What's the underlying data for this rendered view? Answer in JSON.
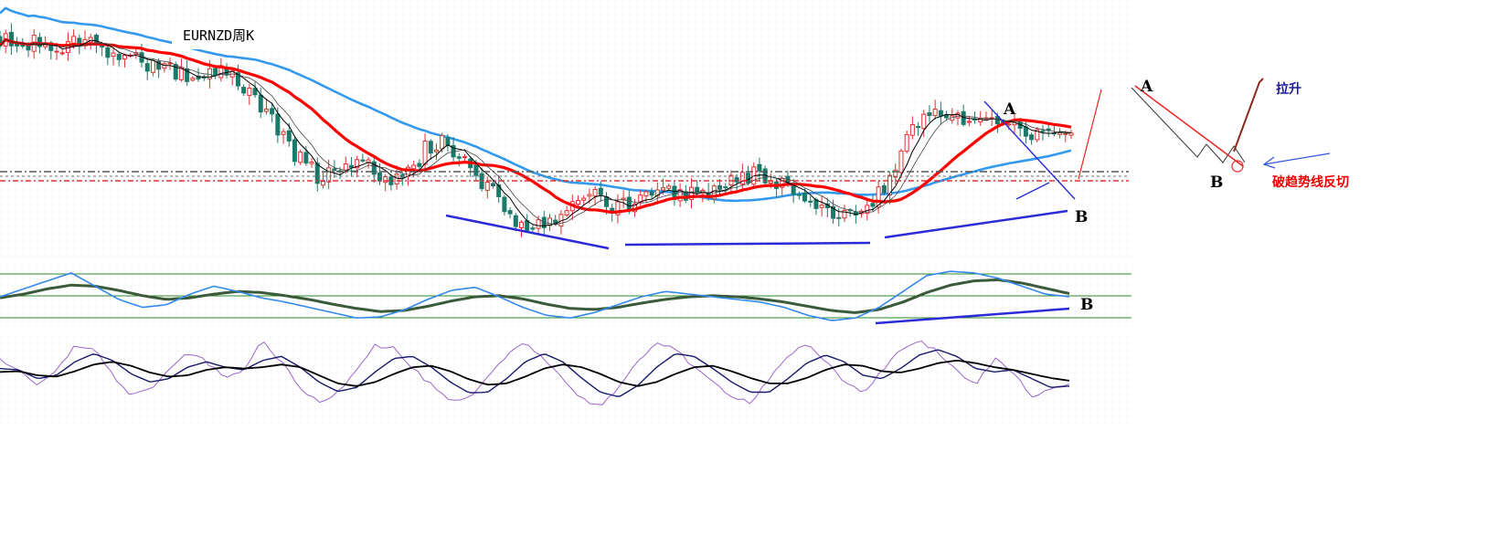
{
  "title": "EURNZD周K",
  "annotations": {
    "label_a_main": "A",
    "label_b_main": "B",
    "label_b_indicator": "B",
    "label_a_sketch": "A",
    "label_b_sketch": "B",
    "label_lift": "拉升",
    "label_break": "破趋势线反切"
  },
  "colors": {
    "bull_candle": "#e03030",
    "bear_candle": "#1a7a6a",
    "ma_fast": "#000000",
    "ma_mid": "#ff0000",
    "ma_slow": "#3399ee",
    "trendline": "#2a2ad8",
    "lift_label": "#1a1a9a",
    "break_label": "#ee0000",
    "osc_fast": "#3388ee",
    "osc_slow": "#3a5a3a",
    "stoch_line": "#9966cc",
    "grid": "#cccccc",
    "guide": "#2a8a2a"
  },
  "chart_data": [
    {
      "type": "candlestick",
      "symbol": "EURNZD",
      "timeframe": "周K",
      "trend": [
        1.0,
        0.97,
        0.98,
        0.93,
        0.95,
        0.99,
        0.96,
        0.9,
        0.88,
        0.86,
        0.84,
        0.82,
        0.8,
        0.82,
        0.78,
        0.7,
        0.6,
        0.46,
        0.36,
        0.3,
        0.33,
        0.38,
        0.34,
        0.28,
        0.32,
        0.44,
        0.5,
        0.4,
        0.3,
        0.22,
        0.1,
        0.04,
        0.08,
        0.14,
        0.18,
        0.22,
        0.16,
        0.16,
        0.2,
        0.24,
        0.2,
        0.22,
        0.26,
        0.28,
        0.32,
        0.3,
        0.26,
        0.22,
        0.18,
        0.14,
        0.12,
        0.16,
        0.26,
        0.42,
        0.58,
        0.64,
        0.6,
        0.58,
        0.6,
        0.56,
        0.52,
        0.5,
        0.52,
        0.55
      ],
      "moving_averages": [
        "fast",
        "mid",
        "slow"
      ],
      "trendlines": 4,
      "grid": true
    },
    {
      "type": "line",
      "indicator": "oscillator",
      "series": [
        {
          "values": [
            0.5,
            0.65,
            0.8,
            0.95,
            0.7,
            0.45,
            0.3,
            0.35,
            0.55,
            0.7,
            0.6,
            0.48,
            0.4,
            0.3,
            0.2,
            0.1,
            0.12,
            0.25,
            0.45,
            0.62,
            0.68,
            0.5,
            0.3,
            0.15,
            0.1,
            0.2,
            0.35,
            0.5,
            0.6,
            0.55,
            0.5,
            0.45,
            0.4,
            0.3,
            0.15,
            0.05,
            0.1,
            0.3,
            0.6,
            0.9,
            0.98,
            0.95,
            0.85,
            0.7,
            0.55,
            0.5
          ]
        },
        {
          "values": [
            0.48,
            0.55,
            0.65,
            0.72,
            0.7,
            0.62,
            0.52,
            0.45,
            0.48,
            0.55,
            0.6,
            0.58,
            0.52,
            0.45,
            0.36,
            0.28,
            0.22,
            0.24,
            0.32,
            0.42,
            0.5,
            0.52,
            0.46,
            0.36,
            0.28,
            0.26,
            0.3,
            0.38,
            0.45,
            0.5,
            0.52,
            0.5,
            0.46,
            0.4,
            0.32,
            0.24,
            0.2,
            0.26,
            0.4,
            0.58,
            0.72,
            0.8,
            0.82,
            0.76,
            0.66,
            0.56
          ]
        }
      ],
      "grid": true
    },
    {
      "type": "line",
      "indicator": "stochastic",
      "series": [
        {
          "values": [
            0.75,
            0.55,
            0.35,
            0.55,
            0.95,
            0.9,
            0.5,
            0.2,
            0.3,
            0.55,
            0.85,
            0.7,
            0.45,
            0.6,
            1.0,
            0.7,
            0.3,
            0.1,
            0.25,
            0.6,
            0.95,
            0.9,
            0.6,
            0.35,
            0.1,
            0.15,
            0.45,
            0.8,
            1.0,
            0.75,
            0.45,
            0.15,
            0.05,
            0.3,
            0.7,
            1.0,
            0.9,
            0.6,
            0.4,
            0.2,
            0.1,
            0.45,
            0.8,
            0.95,
            0.7,
            0.4,
            0.25,
            0.55,
            0.9,
            1.0,
            0.85,
            0.55,
            0.35,
            0.75,
            0.55,
            0.2,
            0.3,
            0.35
          ]
        },
        {
          "values": [
            0.6,
            0.58,
            0.45,
            0.5,
            0.7,
            0.82,
            0.72,
            0.52,
            0.4,
            0.45,
            0.62,
            0.7,
            0.62,
            0.58,
            0.72,
            0.78,
            0.62,
            0.4,
            0.26,
            0.32,
            0.55,
            0.75,
            0.78,
            0.62,
            0.4,
            0.24,
            0.25,
            0.45,
            0.7,
            0.82,
            0.7,
            0.46,
            0.25,
            0.18,
            0.35,
            0.62,
            0.82,
            0.78,
            0.6,
            0.4,
            0.25,
            0.25,
            0.45,
            0.68,
            0.8,
            0.7,
            0.5,
            0.45,
            0.6,
            0.8,
            0.88,
            0.78,
            0.6,
            0.55,
            0.58,
            0.45,
            0.32,
            0.34
          ]
        },
        {
          "values": [
            0.55,
            0.56,
            0.5,
            0.48,
            0.56,
            0.66,
            0.7,
            0.64,
            0.54,
            0.48,
            0.5,
            0.58,
            0.62,
            0.6,
            0.62,
            0.66,
            0.62,
            0.5,
            0.38,
            0.34,
            0.4,
            0.52,
            0.62,
            0.64,
            0.56,
            0.44,
            0.36,
            0.38,
            0.48,
            0.6,
            0.66,
            0.62,
            0.52,
            0.4,
            0.34,
            0.4,
            0.52,
            0.62,
            0.64,
            0.56,
            0.46,
            0.38,
            0.38,
            0.46,
            0.58,
            0.66,
            0.64,
            0.56,
            0.54,
            0.6,
            0.68,
            0.72,
            0.68,
            0.62,
            0.58,
            0.52,
            0.46,
            0.42
          ]
        }
      ],
      "grid": true
    }
  ]
}
